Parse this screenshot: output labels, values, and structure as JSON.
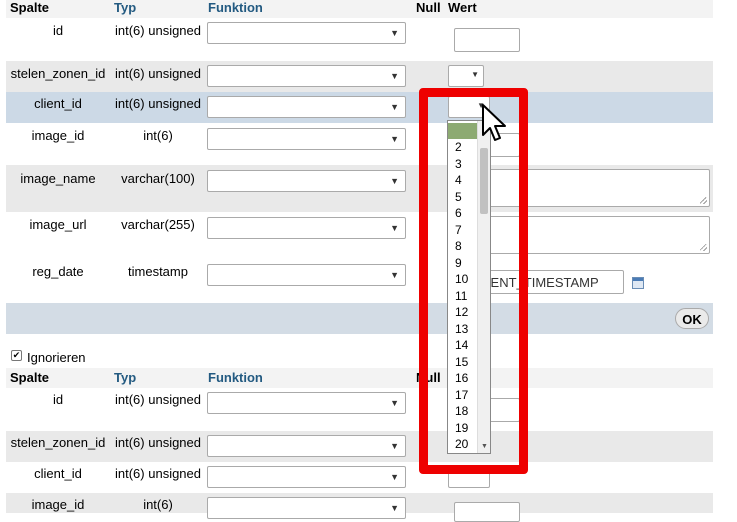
{
  "header1": {
    "spalte": "Spalte",
    "typ": "Typ",
    "funktion": "Funktion",
    "null": "Null",
    "wert": "Wert"
  },
  "header2": {
    "spalte": "Spalte",
    "typ": "Typ",
    "funktion": "Funktion",
    "null": "Null"
  },
  "rows1": [
    {
      "name": "id",
      "type": "int(6) unsigned"
    },
    {
      "name": "stelen_zonen_id",
      "type": "int(6) unsigned"
    },
    {
      "name": "client_id",
      "type": "int(6) unsigned"
    },
    {
      "name": "image_id",
      "type": "int(6)"
    },
    {
      "name": "image_name",
      "type": "varchar(100)"
    },
    {
      "name": "image_url",
      "type": "varchar(255)"
    },
    {
      "name": "reg_date",
      "type": "timestamp",
      "value": "CURRENT_TIMESTAMP"
    }
  ],
  "rows2": [
    {
      "name": "id",
      "type": "int(6) unsigned"
    },
    {
      "name": "stelen_zonen_id",
      "type": "int(6) unsigned"
    },
    {
      "name": "client_id",
      "type": "int(6) unsigned"
    },
    {
      "name": "image_id",
      "type": "int(6)"
    }
  ],
  "ok_label": "OK",
  "ignore_label": "Ignorieren",
  "dropdown_options": [
    "",
    "2",
    "3",
    "4",
    "5",
    "6",
    "7",
    "8",
    "9",
    "10",
    "11",
    "12",
    "13",
    "14",
    "15",
    "16",
    "17",
    "18",
    "19",
    "20"
  ],
  "icons": {
    "calendar": "calendar-icon",
    "checkbox": "checkbox-icon",
    "cursor": "mouse-pointer-icon"
  },
  "colors": {
    "highlight": "#ccd9e6",
    "selected_option": "#8daa72",
    "annotation": "#ee0000"
  }
}
